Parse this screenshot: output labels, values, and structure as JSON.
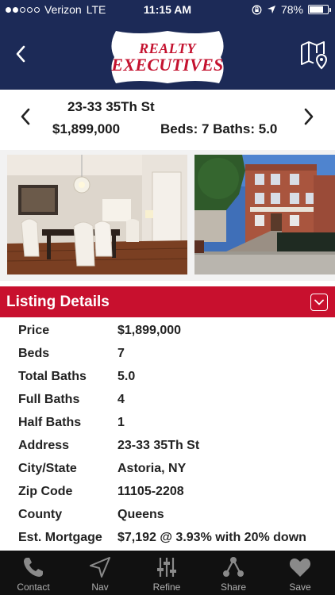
{
  "status_bar": {
    "carrier": "Verizon",
    "network": "LTE",
    "time": "11:15 AM",
    "battery_percent": "78%",
    "battery_level": 0.78,
    "signal_bars": 2
  },
  "header": {
    "logo_line1": "REALTY",
    "logo_line2": "EXECUTIVES",
    "brand_color": "#1c2a57",
    "logo_color": "#c4122f",
    "back_icon": "chevron-left-icon",
    "map_icon": "map-pin-icon"
  },
  "summary": {
    "address": "23-33 35Th St",
    "price": "$1,899,000",
    "beds_baths": "Beds: 7  Baths: 5.0"
  },
  "photos": [
    {
      "subject": "dining room"
    },
    {
      "subject": "building exterior"
    }
  ],
  "details": {
    "title": "Listing Details",
    "accent_color": "#c8102e",
    "rows": [
      {
        "label": "Price",
        "value": "$1,899,000"
      },
      {
        "label": "Beds",
        "value": "7"
      },
      {
        "label": "Total Baths",
        "value": "5.0"
      },
      {
        "label": "Full Baths",
        "value": "4"
      },
      {
        "label": "Half Baths",
        "value": "1"
      },
      {
        "label": "Address",
        "value": "23-33 35Th St"
      },
      {
        "label": "City/State",
        "value": "Astoria, NY"
      },
      {
        "label": "Zip Code",
        "value": "11105-2208"
      },
      {
        "label": "County",
        "value": "Queens"
      },
      {
        "label": "Est. Mortgage",
        "value": "$7,192 @ 3.93% with 20% down"
      }
    ]
  },
  "tabbar": {
    "items": [
      {
        "label": "Contact",
        "icon": "phone-icon"
      },
      {
        "label": "Nav",
        "icon": "navigation-arrow-icon"
      },
      {
        "label": "Refine",
        "icon": "sliders-icon"
      },
      {
        "label": "Share",
        "icon": "share-icon"
      },
      {
        "label": "Save",
        "icon": "heart-icon"
      }
    ]
  }
}
